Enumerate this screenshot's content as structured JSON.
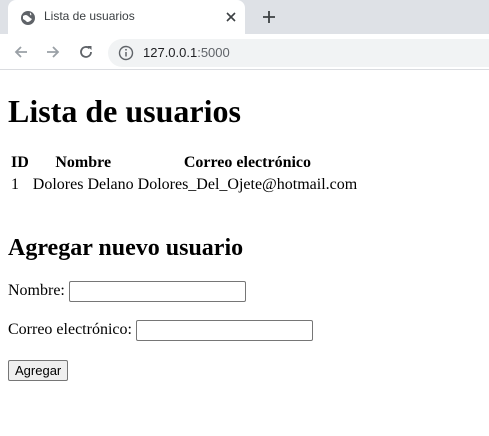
{
  "browser": {
    "tab_title": "Lista de usuarios",
    "url_host": "127.0.0.1",
    "url_port": ":5000"
  },
  "page": {
    "title": "Lista de usuarios",
    "table": {
      "headers": {
        "id": "ID",
        "name": "Nombre",
        "email": "Correo electrónico"
      },
      "rows": [
        {
          "id": "1",
          "name": "Dolores Delano",
          "email": "Dolores_Del_Ojete@hotmail.com"
        }
      ]
    },
    "form": {
      "heading": "Agregar nuevo usuario",
      "name_label": "Nombre:",
      "name_value": "",
      "email_label": "Correo electrónico:",
      "email_value": "",
      "submit_label": "Agregar"
    }
  }
}
